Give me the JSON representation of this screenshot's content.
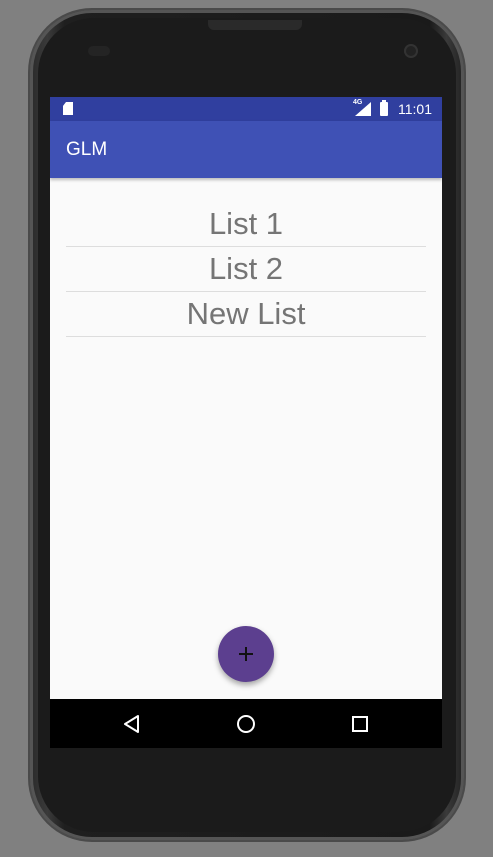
{
  "status_bar": {
    "network": "4G",
    "time": "11:01"
  },
  "app_bar": {
    "title": "GLM"
  },
  "lists": [
    {
      "label": "List 1"
    },
    {
      "label": "List 2"
    },
    {
      "label": "New List"
    }
  ],
  "fab": {
    "icon": "plus-icon"
  },
  "nav": {
    "back_icon": "back-triangle-icon",
    "home_icon": "home-circle-icon",
    "recents_icon": "recents-square-icon"
  },
  "colors": {
    "primary": "#3f51b5",
    "primary_dark": "#303f9f",
    "accent": "#5c3f8f"
  }
}
